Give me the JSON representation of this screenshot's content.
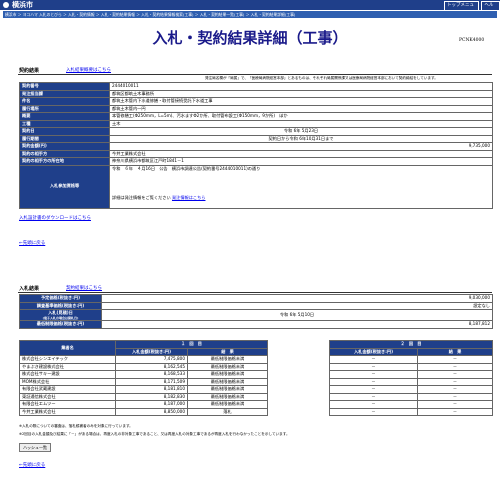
{
  "header": {
    "city": "横浜市",
    "top_menu": "トップメニュー",
    "help": "ヘルプ",
    "breadcrumb": "横浜市 ＞ ヨコハマ 入札のとびら ＞ 入札・契約情報 ＞ 入札・契約結果情報 ＞ 入札・契約結果情報検索(工事) ＞ 入札・契約結果一覧(工事) ＞ 入札・契約結果詳細(工事)"
  },
  "page": {
    "title": "入札・契約結果詳細（工事）",
    "code": "PCNK4000"
  },
  "contract": {
    "section_label": "契約結果",
    "summary_link": "入札結果概要はこちら",
    "note": "発注局名欄が「局属」で、「医療局病院経営本部」とあるものは、それぞれ局属関係課又は医療局病院経営本部において契約締結をしています。",
    "rows": [
      {
        "label": "契約番号",
        "value": "2444010011"
      },
      {
        "label": "発注担当課",
        "value": "都筑区都筑土木事務所"
      },
      {
        "label": "件名",
        "value": "都筑土木管内下水道修繕・取付管接続受託下水道工事"
      },
      {
        "label": "履行場所",
        "value": "都筑土木管内一円"
      },
      {
        "label": "概要",
        "value": "本管修繕工(Φ250mm，L=5m)、汚水ますΦ2か所、取付管布設工(Φ150mm，9か所)　ほか"
      },
      {
        "label": "工種",
        "value": "土木"
      },
      {
        "label": "契約日",
        "value": "令和 6年 5月23日"
      },
      {
        "label": "履行期間",
        "value": "契約日から令和 6年10月31日まで"
      },
      {
        "label": "契約金額(円)",
        "value": "9,735,000"
      },
      {
        "label": "契約の相手方",
        "value": "今井工業株式会社"
      },
      {
        "label": "契約の相手方の所在地",
        "value": "神奈川県横浜市都筑区江戸町1841－1"
      }
    ],
    "bid_docs_label": "入札参加資格等",
    "bid_docs_line": "令和　６年　４月16日　公告　横浜市調達公告(契約番号2444010011)の通り",
    "bid_docs_more": "詳細は発注情報をご覧ください",
    "bid_docs_more_link": "発注情報はこちら",
    "download_link": "入札設計書のダウンロードはこちら",
    "back_link": "←先頭に戻る"
  },
  "bidding": {
    "section_label": "入札結果",
    "summary_link": "契約結果はこちら",
    "rows": [
      {
        "label": "予定価格(税抜き:円)",
        "value": "9,030,000"
      },
      {
        "label": "調査基準価格(税抜き:円)",
        "value": "設定なし"
      },
      {
        "label": "入札(見積)日",
        "sublabel": "(電子入札の場合は開札日)",
        "value": "令和 6年 5月10日"
      },
      {
        "label": "最低制限価格(税抜き:円)",
        "value": "8,187,812"
      }
    ],
    "results_header": {
      "company": "業者名",
      "round1": "１　回　目",
      "round2": "２　回　目",
      "amount": "入札金額(税抜き:円)",
      "result": "結　果"
    },
    "bidders": [
      {
        "name": "株式会社シンエイテック",
        "amount1": "7,475,800",
        "result1": "最低制限価格未満",
        "amount2": "－",
        "result2": "－"
      },
      {
        "name": "やまぶき建設株式会社",
        "amount1": "8,162,545",
        "result1": "最低制限価格未満",
        "amount2": "－",
        "result2": "－"
      },
      {
        "name": "株式会社サキー建設",
        "amount1": "8,168,533",
        "result1": "最低制限価格未満",
        "amount2": "－",
        "result2": "－"
      },
      {
        "name": "MOM株式会社",
        "amount1": "8,171,509",
        "result1": "最低制限価格未満",
        "amount2": "－",
        "result2": "－"
      },
      {
        "name": "有限会社武蔵建設",
        "amount1": "8,181,810",
        "result1": "最低制限価格未満",
        "amount2": "－",
        "result2": "－"
      },
      {
        "name": "東証通信株式会社",
        "amount1": "8,182,830",
        "result1": "最低制限価格未満",
        "amount2": "－",
        "result2": "－"
      },
      {
        "name": "有限会社エムツー",
        "amount1": "8,187,000",
        "result1": "最低制限価格未満",
        "amount2": "－",
        "result2": "－"
      },
      {
        "name": "今井工業株式会社",
        "amount1": "8,850,000",
        "result1": "落札",
        "amount2": "－",
        "result2": "－"
      }
    ],
    "footnote1": "※入札の際についての審査は、落札候補者のみを対象に行っています。",
    "footnote2": "※2回目の入札金額及び結果に「－」がある場合は、再度入札の非対象工事であること、又は再度入札の対象工事であるが再度入札を行わなかったことを示しています。",
    "hash_button": "ハッシュ一覧",
    "back_link": "←先頭に戻る"
  }
}
